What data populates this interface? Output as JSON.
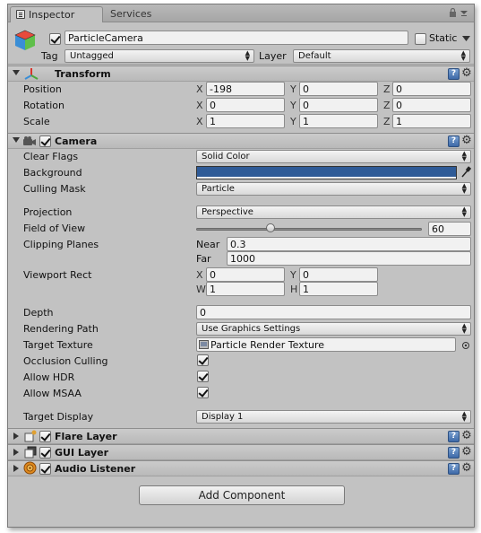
{
  "tabs": [
    {
      "label": "Inspector"
    },
    {
      "label": "Services"
    }
  ],
  "header": {
    "object_name": "ParticleCamera",
    "static_label": "Static",
    "tag_label": "Tag",
    "tag_value": "Untagged",
    "layer_label": "Layer",
    "layer_value": "Default"
  },
  "transform": {
    "title": "Transform",
    "position": {
      "label": "Position",
      "x": "-198",
      "y": "0",
      "z": "0"
    },
    "rotation": {
      "label": "Rotation",
      "x": "0",
      "y": "0",
      "z": "0"
    },
    "scale": {
      "label": "Scale",
      "x": "1",
      "y": "1",
      "z": "1"
    },
    "axis_x": "X",
    "axis_y": "Y",
    "axis_z": "Z"
  },
  "camera": {
    "title": "Camera",
    "clear_flags": {
      "label": "Clear Flags",
      "value": "Solid Color"
    },
    "background": {
      "label": "Background",
      "color": "#2f5b97"
    },
    "culling_mask": {
      "label": "Culling Mask",
      "value": "Particle"
    },
    "projection": {
      "label": "Projection",
      "value": "Perspective"
    },
    "field_of_view": {
      "label": "Field of View",
      "value": "60",
      "fraction": 0.33
    },
    "clipping_planes": {
      "label": "Clipping Planes",
      "near_label": "Near",
      "near": "0.3",
      "far_label": "Far",
      "far": "1000"
    },
    "viewport_rect": {
      "label": "Viewport Rect",
      "x_label": "X",
      "x": "0",
      "y_label": "Y",
      "y": "0",
      "w_label": "W",
      "w": "1",
      "h_label": "H",
      "h": "1"
    },
    "depth": {
      "label": "Depth",
      "value": "0"
    },
    "rendering_path": {
      "label": "Rendering Path",
      "value": "Use Graphics Settings"
    },
    "target_texture": {
      "label": "Target Texture",
      "value": "Particle Render Texture"
    },
    "occlusion_culling": {
      "label": "Occlusion Culling",
      "checked": true
    },
    "allow_hdr": {
      "label": "Allow HDR",
      "checked": true
    },
    "allow_msaa": {
      "label": "Allow MSAA",
      "checked": true
    },
    "target_display": {
      "label": "Target Display",
      "value": "Display 1"
    }
  },
  "flare_layer": {
    "title": "Flare Layer"
  },
  "gui_layer": {
    "title": "GUI Layer"
  },
  "audio_listener": {
    "title": "Audio Listener"
  },
  "add_component_label": "Add Component"
}
